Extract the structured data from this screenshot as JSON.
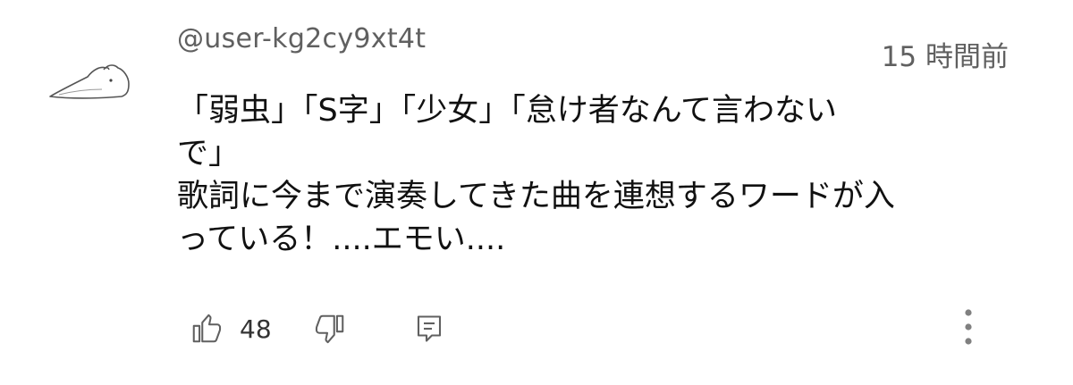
{
  "comment": {
    "author": "@user-kg2cy9xt4t",
    "timestamp": "15 時間前",
    "text_lines": [
      "「弱虫」「S字」「少女」「怠け者なんて言わない",
      "で」",
      "歌詞に今まで演奏してきた曲を連想するワードが入",
      "っている！....エモい...."
    ],
    "like_count": "48"
  },
  "icons": {
    "avatar": "bear-doodle-avatar",
    "like": "thumbs-up-icon",
    "dislike": "thumbs-down-icon",
    "reply": "comment-icon",
    "more": "more-vert-icon"
  },
  "colors": {
    "meta_text": "#606060",
    "body_text": "#111111",
    "icon": "#606060"
  }
}
